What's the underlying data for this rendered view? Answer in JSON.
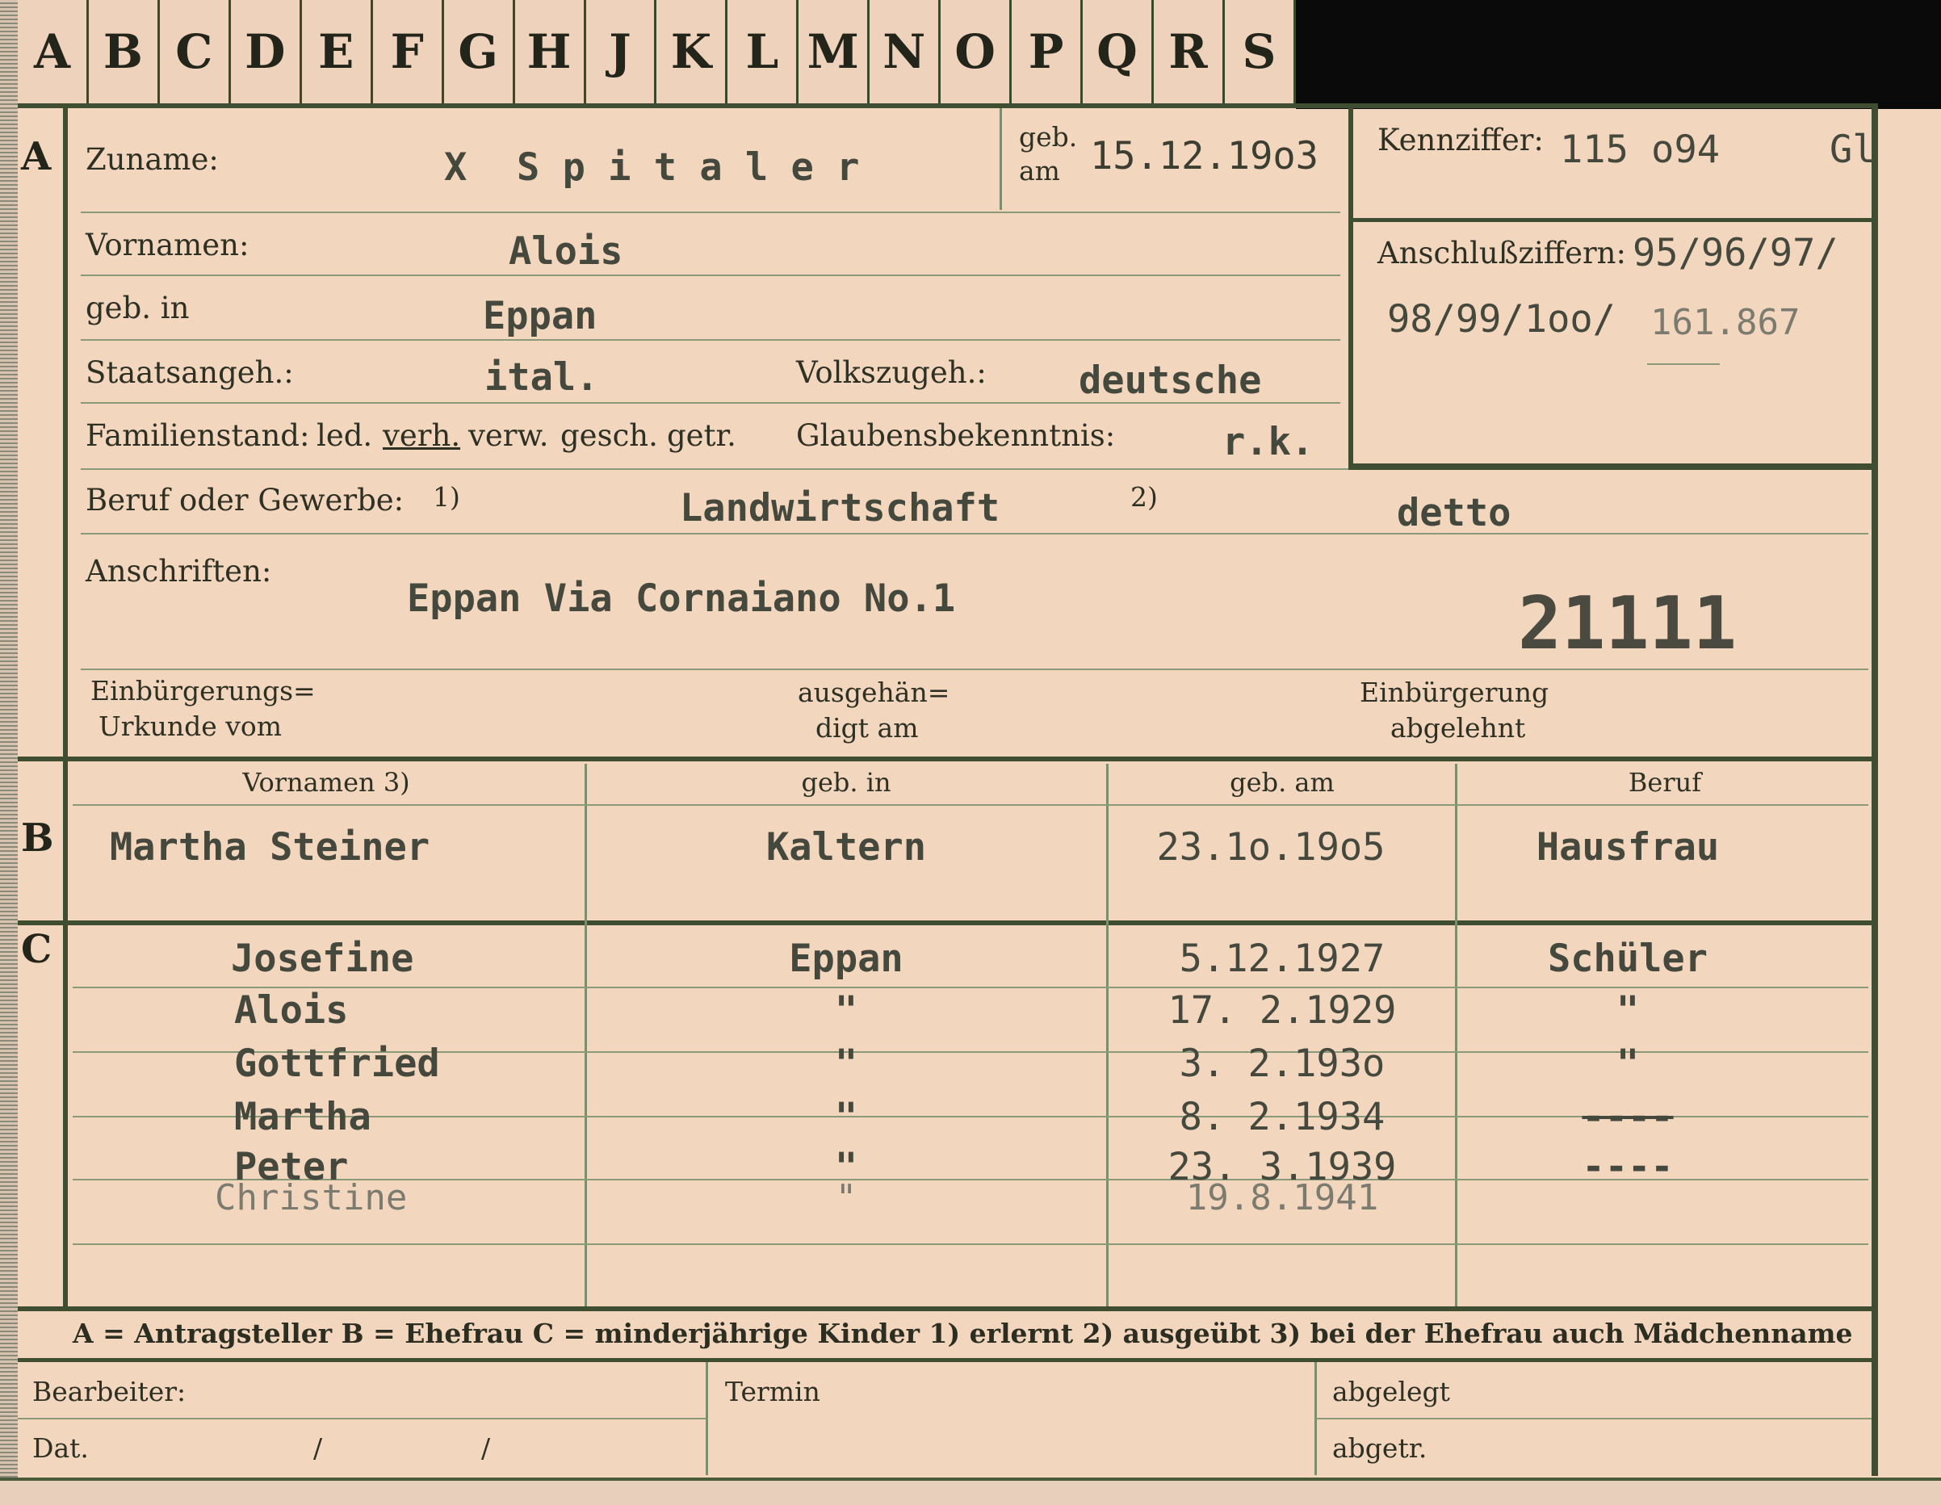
{
  "tabs": [
    "A",
    "B",
    "C",
    "D",
    "E",
    "F",
    "G",
    "H",
    "J",
    "K",
    "L",
    "M",
    "N",
    "O",
    "P",
    "Q",
    "R",
    "S"
  ],
  "section_letters": {
    "a": "A",
    "b": "B",
    "c": "C"
  },
  "applicant": {
    "surname_label": "Zuname:",
    "surname_mark": "X",
    "surname": "S p i t a l e r",
    "born_on_label_1": "geb.",
    "born_on_label_2": "am",
    "born_on": "15.12.19o3",
    "ref_label": "Kennziffer:",
    "ref_number": "115 o94",
    "ref_suffix": "Gl",
    "link_label": "Anschlußziffern:",
    "link_line1": "95/96/97/",
    "link_line2": "98/99/1oo/",
    "link_handwritten": "161.867",
    "firstnames_label": "Vornamen:",
    "firstnames": "Alois",
    "birthplace_label": "geb. in",
    "birthplace": "Eppan",
    "citizenship_label": "Staatsangeh.:",
    "citizenship": "ital.",
    "ethnicity_label": "Volkszugeh.:",
    "ethnicity": "deutsche",
    "marital_label": "Familienstand:",
    "marital_options": [
      "led.",
      "verh.",
      "verw.",
      "gesch.",
      "getr."
    ],
    "religion_label": "Glaubensbekenntnis:",
    "religion": "r.k.",
    "profession_label": "Beruf oder Gewerbe:",
    "footnote1": "1)",
    "profession": "Landwirtschaft",
    "footnote2": "2)",
    "profession_practised": "detto",
    "address_label": "Anschriften:",
    "address": "Eppan Via Cornaiano No.1",
    "stamp_number": "21111",
    "naturalization_label_1": "Einbürgerungs=",
    "naturalization_label_2": "Urkunde vom",
    "handed_label_1": "ausgehän=",
    "handed_label_2": "digt am",
    "rejected_label_1": "Einbürgerung",
    "rejected_label_2": "abgelehnt"
  },
  "columns": {
    "firstnames": "Vornamen 3)",
    "birthplace": "geb. in",
    "birthdate": "geb. am",
    "profession": "Beruf"
  },
  "wife": {
    "name": "Martha Steiner",
    "birthplace": "Kaltern",
    "birthdate": "23.1o.19o5",
    "profession": "Hausfrau"
  },
  "children": [
    {
      "name": "Josefine",
      "birthplace": "Eppan",
      "birthdate": "5.12.1927",
      "profession": "Schüler"
    },
    {
      "name": "Alois",
      "birthplace": "\"",
      "birthdate": "17. 2.1929",
      "profession": "\""
    },
    {
      "name": "Gottfried",
      "birthplace": "\"",
      "birthdate": "3. 2.193o",
      "profession": "\""
    },
    {
      "name": "Martha",
      "birthplace": "\"",
      "birthdate": "8. 2.1934",
      "profession": "----"
    },
    {
      "name": "Peter",
      "birthplace": "\"",
      "birthdate": "23. 3.1939",
      "profession": "----"
    },
    {
      "name": "Christine",
      "birthplace": "\"",
      "birthdate": "19.8.1941",
      "profession": ""
    }
  ],
  "legend": "A = Antragsteller   B = Ehefrau   C = minderjährige Kinder   1) erlernt   2) ausgeübt   3) bei der Ehefrau auch Mädchenname",
  "footer": {
    "clerk": "Bearbeiter:",
    "date": "Dat.",
    "slash1": "/",
    "slash2": "/",
    "deadline": "Termin",
    "filed": "abgelegt",
    "removed": "abgetr."
  }
}
